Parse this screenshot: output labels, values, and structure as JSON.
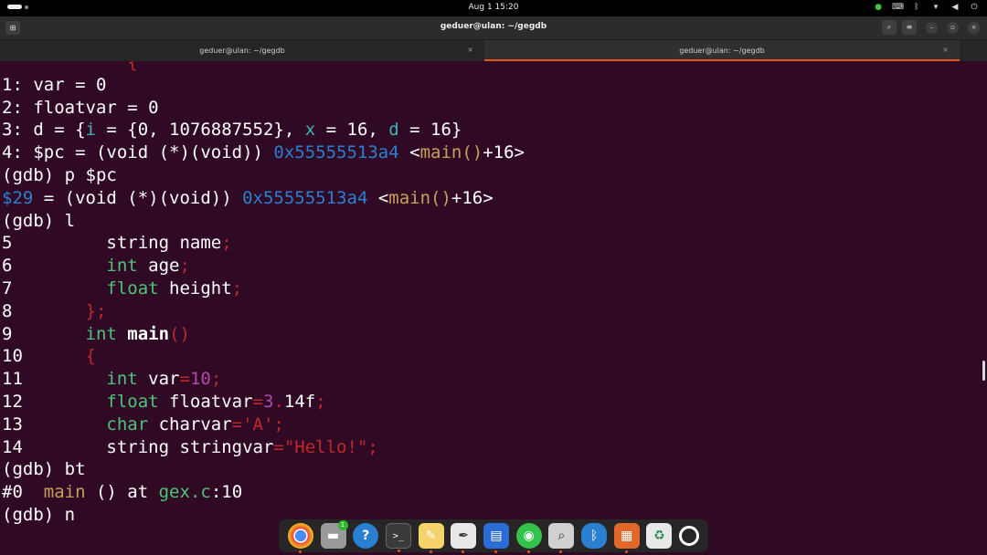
{
  "system": {
    "clock": "Aug 1  15:20",
    "tray_icons": [
      "wechat-icon",
      "keyboard-icon",
      "bluetooth-icon",
      "wifi-icon",
      "volume-icon",
      "power-icon"
    ]
  },
  "header": {
    "title": "geduer@ulan: ~/gegdb"
  },
  "tabs": [
    {
      "label": "geduer@ulan: ~/gegdb",
      "close": "×"
    },
    {
      "label": "geduer@ulan: ~/gegdb",
      "close": "×"
    }
  ],
  "terminal": {
    "lines": [
      [
        [
          "c-red",
          "            {"
        ]
      ],
      [
        [
          "c-white",
          "1: var = 0"
        ]
      ],
      [
        [
          "c-white",
          "2: floatvar = 0"
        ]
      ],
      [
        [
          "c-white",
          "3: d = {"
        ],
        [
          "c-cyan",
          "i"
        ],
        [
          "c-white",
          " = {0, 1076887552}, "
        ],
        [
          "c-cyan",
          "x"
        ],
        [
          "c-white",
          " = 16, "
        ],
        [
          "c-cyan",
          "d"
        ],
        [
          "c-white",
          " = 16}"
        ]
      ],
      [
        [
          "c-white",
          "4: $pc = (void (*)(void)) "
        ],
        [
          "c-blue",
          "0x55555513a4"
        ],
        [
          "c-white",
          " <"
        ],
        [
          "c-brown",
          "main()"
        ],
        [
          "c-white",
          "+16>"
        ]
      ],
      [
        [
          "c-white",
          "(gdb) p $pc"
        ]
      ],
      [
        [
          "c-blue",
          "$29"
        ],
        [
          "c-white",
          " = (void (*)(void)) "
        ],
        [
          "c-blue",
          "0x55555513a4"
        ],
        [
          "c-white",
          " <"
        ],
        [
          "c-brown",
          "main()"
        ],
        [
          "c-white",
          "+16>"
        ]
      ],
      [
        [
          "c-white",
          "(gdb) l"
        ]
      ],
      [
        [
          "c-white",
          "5         string name"
        ],
        [
          "c-red",
          ";"
        ]
      ],
      [
        [
          "c-white",
          "6         "
        ],
        [
          "c-green",
          "int"
        ],
        [
          "c-white",
          " age"
        ],
        [
          "c-red",
          ";"
        ]
      ],
      [
        [
          "c-white",
          "7         "
        ],
        [
          "c-green",
          "float"
        ],
        [
          "c-white",
          " height"
        ],
        [
          "c-red",
          ";"
        ]
      ],
      [
        [
          "c-white",
          "8       "
        ],
        [
          "c-red",
          "};"
        ]
      ],
      [
        [
          "c-white",
          "9       "
        ],
        [
          "c-green",
          "int"
        ],
        [
          "c-white",
          " "
        ],
        [
          "c-bold",
          "main"
        ],
        [
          "c-red",
          "()"
        ]
      ],
      [
        [
          "c-white",
          "10      "
        ],
        [
          "c-red",
          "{"
        ]
      ],
      [
        [
          "c-white",
          "11        "
        ],
        [
          "c-green",
          "int"
        ],
        [
          "c-white",
          " var"
        ],
        [
          "c-red",
          "="
        ],
        [
          "c-mag",
          "10"
        ],
        [
          "c-red",
          ";"
        ]
      ],
      [
        [
          "c-white",
          "12        "
        ],
        [
          "c-green",
          "float"
        ],
        [
          "c-white",
          " floatvar"
        ],
        [
          "c-red",
          "="
        ],
        [
          "c-mag",
          "3"
        ],
        [
          "c-red",
          "."
        ],
        [
          "c-white",
          "14f"
        ],
        [
          "c-red",
          ";"
        ]
      ],
      [
        [
          "c-white",
          "13        "
        ],
        [
          "c-green",
          "char"
        ],
        [
          "c-white",
          " charvar"
        ],
        [
          "c-red",
          "='A';"
        ]
      ],
      [
        [
          "c-white",
          "14        string stringvar"
        ],
        [
          "c-red",
          "=\"Hello!\";"
        ]
      ],
      [
        [
          "c-white",
          "(gdb) bt"
        ]
      ],
      [
        [
          "c-white",
          "#0  "
        ],
        [
          "c-brown",
          "main"
        ],
        [
          "c-white",
          " () at "
        ],
        [
          "c-green",
          "gex.c"
        ],
        [
          "c-white",
          ":10"
        ]
      ],
      [
        [
          "c-white",
          "(gdb) n"
        ]
      ]
    ]
  },
  "dock": {
    "items": [
      {
        "name": "chrome-icon",
        "glyph": "",
        "cls": "i-chrome",
        "running": true
      },
      {
        "name": "files-icon",
        "glyph": "▬",
        "cls": "i-files",
        "running": false,
        "badge": "1"
      },
      {
        "name": "help-icon",
        "glyph": "?",
        "cls": "i-help",
        "running": false
      },
      {
        "name": "terminal-icon",
        "glyph": ">_",
        "cls": "i-term",
        "running": true
      },
      {
        "name": "text-editor-icon",
        "glyph": "✎",
        "cls": "i-editor",
        "running": true
      },
      {
        "name": "inkscape-icon",
        "glyph": "✒",
        "cls": "i-inkscape",
        "running": true
      },
      {
        "name": "writer-icon",
        "glyph": "▤",
        "cls": "i-writer",
        "running": true
      },
      {
        "name": "wechat-icon",
        "glyph": "◉",
        "cls": "i-wechat",
        "running": true
      },
      {
        "name": "image-viewer-icon",
        "glyph": "⌕",
        "cls": "i-viewer",
        "running": true
      },
      {
        "name": "bluetooth-icon",
        "glyph": "ᛒ",
        "cls": "i-bt",
        "running": false
      },
      {
        "name": "impress-icon",
        "glyph": "▦",
        "cls": "i-impress",
        "running": true
      },
      {
        "name": "trash-icon",
        "glyph": "♻",
        "cls": "i-trash",
        "running": false
      },
      {
        "name": "show-apps-icon",
        "glyph": "",
        "cls": "i-apps",
        "running": false
      }
    ]
  }
}
